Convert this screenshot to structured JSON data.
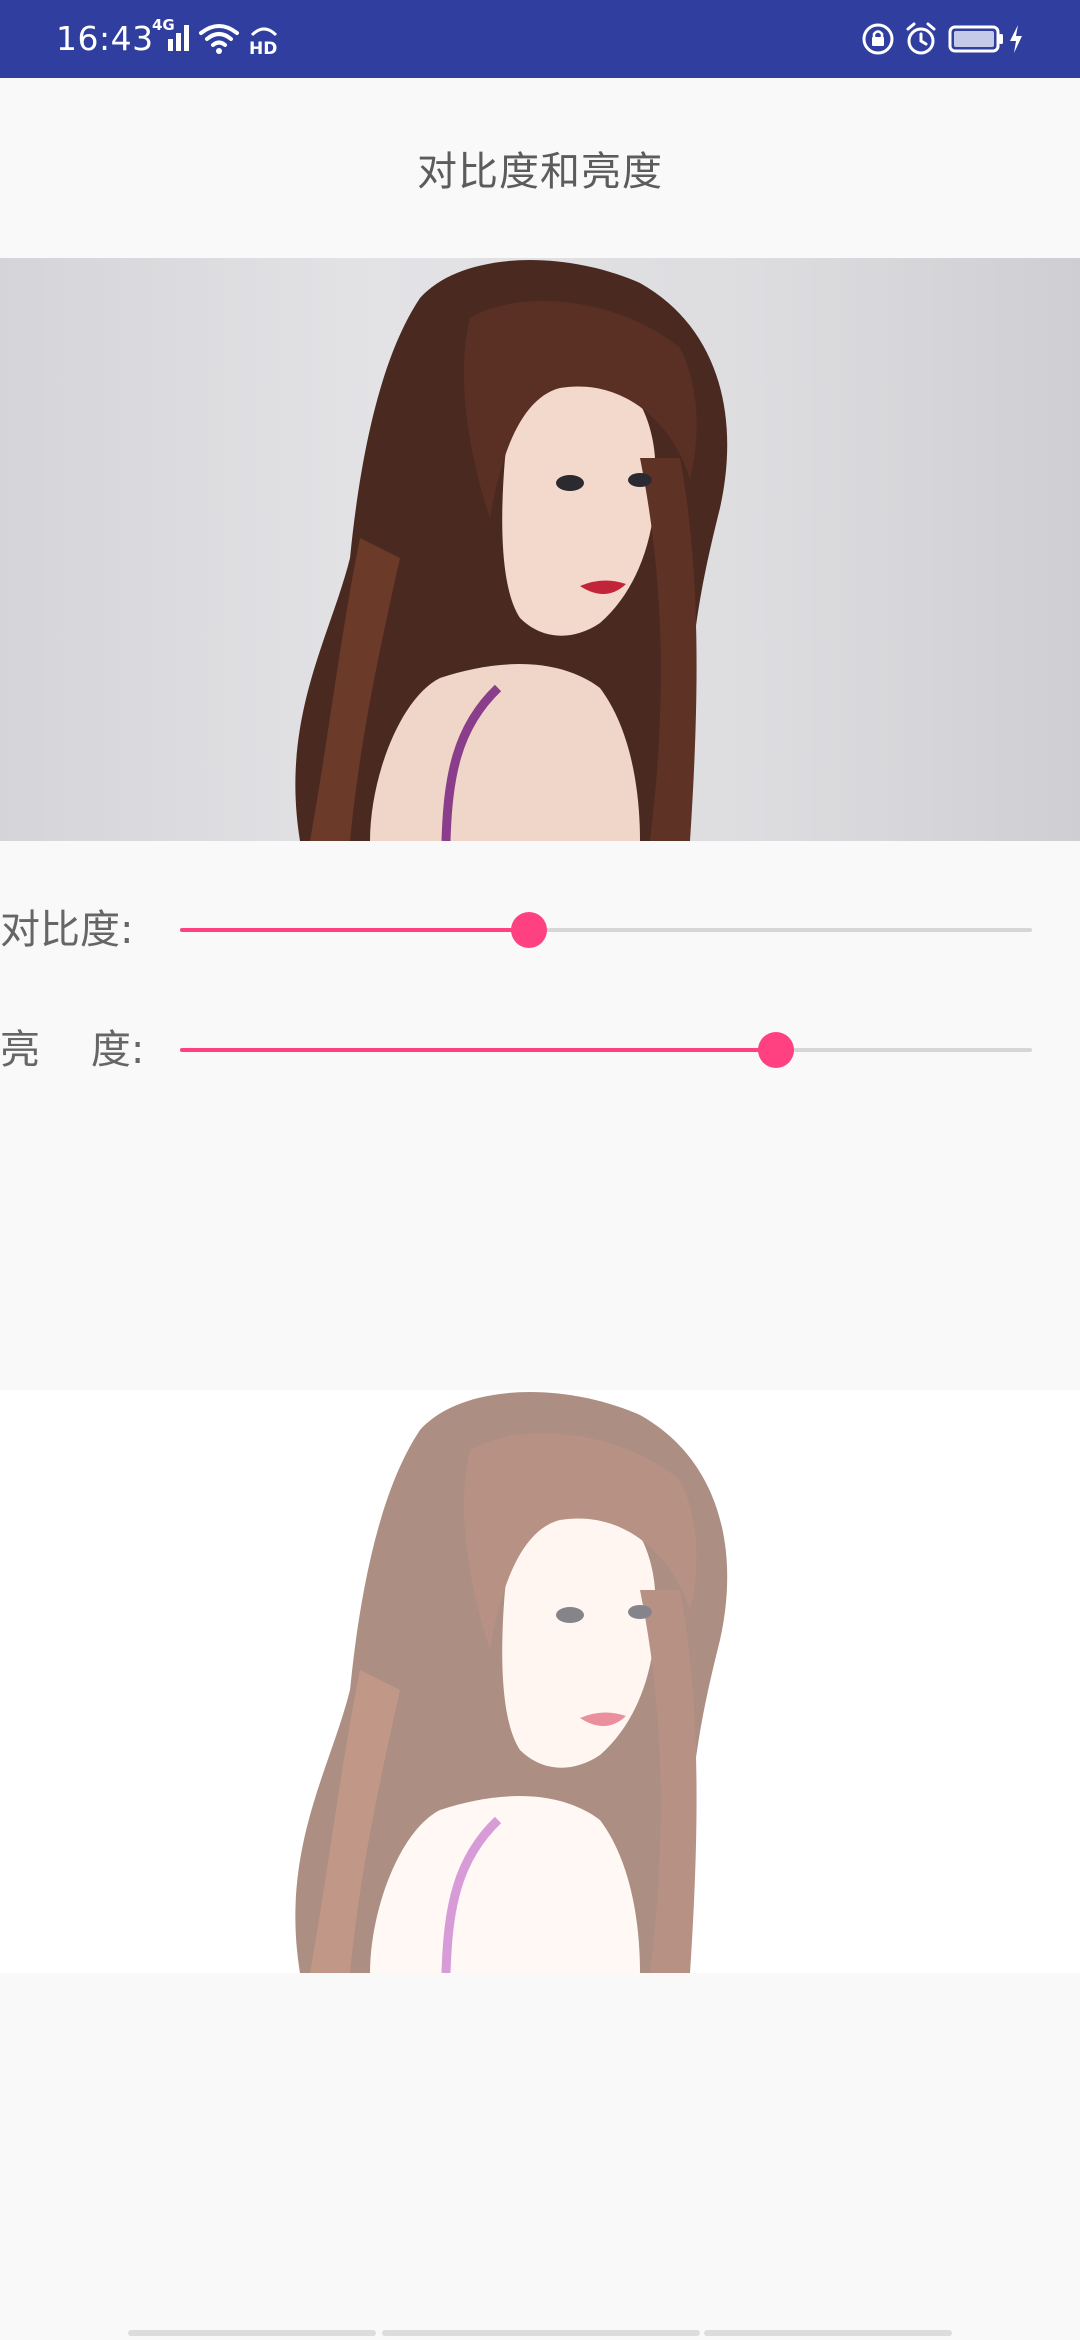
{
  "status_bar": {
    "time": "16:43",
    "network_label": "4G",
    "icons": [
      "signal-icon",
      "wifi-icon",
      "hd-icon",
      "rotation-lock-icon",
      "alarm-icon",
      "battery-icon",
      "charging-icon"
    ],
    "background_color": "#303f9f"
  },
  "header": {
    "title": "对比度和亮度"
  },
  "images": {
    "original": {
      "alt": "original-photo"
    },
    "adjusted": {
      "alt": "adjusted-photo"
    }
  },
  "sliders": [
    {
      "label": "对比度:",
      "value_fraction": 0.41
    },
    {
      "label": "亮    度:",
      "value_fraction": 0.7
    }
  ],
  "colors": {
    "accent": "#ff4081",
    "track": "#d6d6d6",
    "background": "#f9f9f9"
  }
}
